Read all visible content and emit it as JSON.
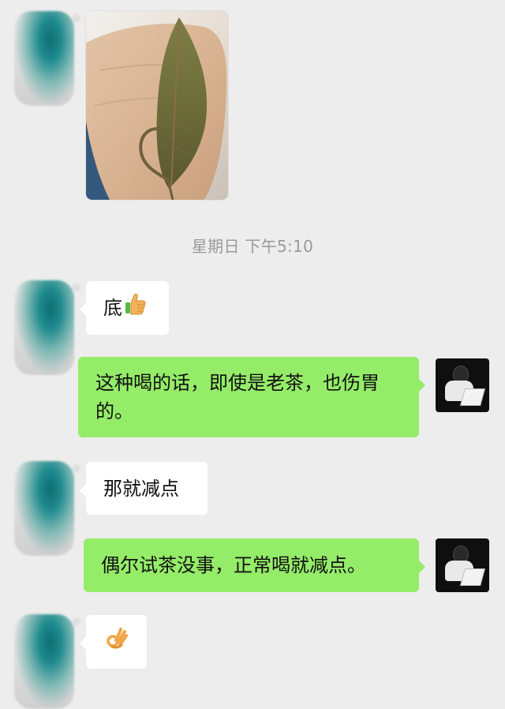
{
  "chat": {
    "timestamp": "星期日 下午5:10",
    "messages": [
      {
        "side": "left",
        "type": "image",
        "image": "tea-leaf-in-hand-photo"
      },
      {
        "side": "left",
        "type": "text",
        "text": "底",
        "emoji": "thumbs-up-icon"
      },
      {
        "side": "right",
        "type": "text",
        "text": "这种喝的话，即使是老茶，也伤胃的。"
      },
      {
        "side": "left",
        "type": "text",
        "text": "那就减点"
      },
      {
        "side": "right",
        "type": "text",
        "text": "偶尔试茶没事，正常喝就减点。"
      },
      {
        "side": "left",
        "type": "emoji",
        "emoji": "ok-hand-icon"
      }
    ]
  },
  "colors": {
    "background": "#ededed",
    "bubble_left": "#ffffff",
    "bubble_right": "#95ec69",
    "timestamp": "#9a9a9a"
  }
}
